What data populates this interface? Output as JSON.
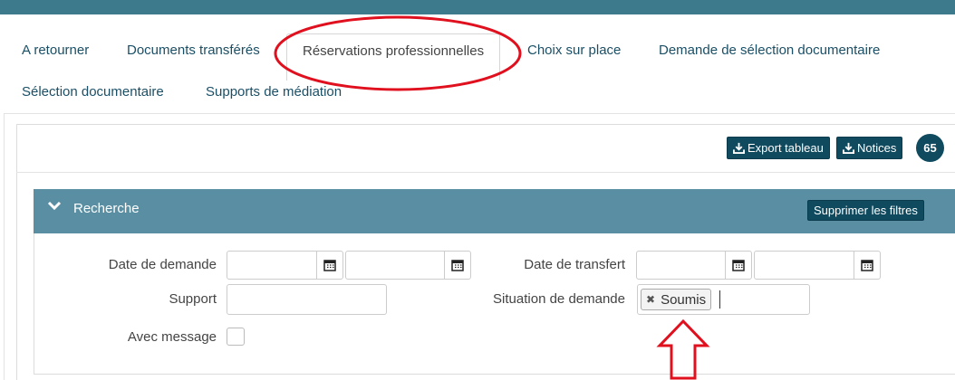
{
  "tabs": [
    {
      "label": "A retourner"
    },
    {
      "label": "Documents transférés"
    },
    {
      "label": "Réservations professionnelles",
      "active": true
    },
    {
      "label": "Choix sur place"
    },
    {
      "label": "Demande de sélection documentaire"
    },
    {
      "label": "Sélection documentaire"
    },
    {
      "label": "Supports de médiation"
    }
  ],
  "toolbar": {
    "export_label": "Export tableau",
    "notices_label": "Notices",
    "count": "65"
  },
  "search": {
    "title": "Recherche",
    "clear_filters_label": "Supprimer les filtres",
    "fields": {
      "date_demande_label": "Date de demande",
      "date_transfert_label": "Date de transfert",
      "support_label": "Support",
      "situation_label": "Situation de demande",
      "avec_message_label": "Avec message"
    },
    "situation_tags": [
      "Soumis"
    ]
  },
  "colors": {
    "topbar": "#3d7a8c",
    "tab_text": "#1a4f66",
    "dark_button": "#0f4a5f",
    "search_header": "#5a8fa3",
    "annotation": "#e0101e"
  },
  "icons": {
    "download": "download-icon",
    "calendar": "calendar-icon",
    "chevron": "chevron-down-icon",
    "remove": "close-icon"
  }
}
